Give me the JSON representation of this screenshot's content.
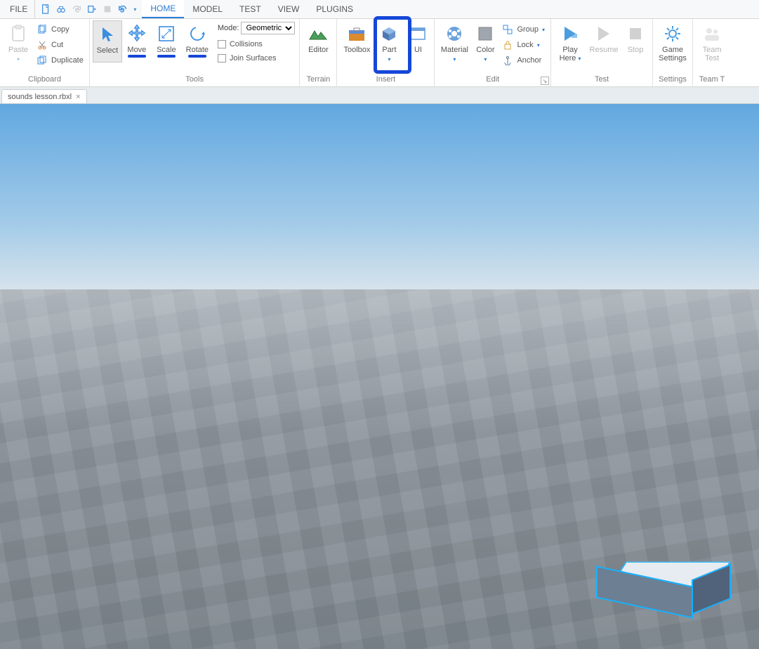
{
  "menubar": {
    "file": "FILE",
    "tabs": [
      "HOME",
      "MODEL",
      "TEST",
      "VIEW",
      "PLUGINS"
    ],
    "active_tab": 0
  },
  "clipboard": {
    "paste": "Paste",
    "copy": "Copy",
    "cut": "Cut",
    "duplicate": "Duplicate",
    "group_label": "Clipboard"
  },
  "tools": {
    "select": "Select",
    "move": "Move",
    "scale": "Scale",
    "rotate": "Rotate",
    "mode_label": "Mode:",
    "mode_value": "Geometric",
    "collisions": "Collisions",
    "join_surfaces": "Join Surfaces",
    "group_label": "Tools"
  },
  "terrain": {
    "editor": "Editor",
    "group_label": "Terrain"
  },
  "insert": {
    "toolbox": "Toolbox",
    "part": "Part",
    "ui": "UI",
    "group_label": "Insert"
  },
  "edit": {
    "material": "Material",
    "color": "Color",
    "group_btn": "Group",
    "lock": "Lock",
    "anchor": "Anchor",
    "group_label": "Edit"
  },
  "test": {
    "play": "Play",
    "here": "Here",
    "resume": "Resume",
    "stop": "Stop",
    "group_label": "Test"
  },
  "settings": {
    "game": "Game",
    "settings": "Settings",
    "group_label": "Settings"
  },
  "team": {
    "team": "Team",
    "test": "Test",
    "group_label": "Team T"
  },
  "doc_tab": {
    "name": "sounds lesson.rbxl"
  }
}
